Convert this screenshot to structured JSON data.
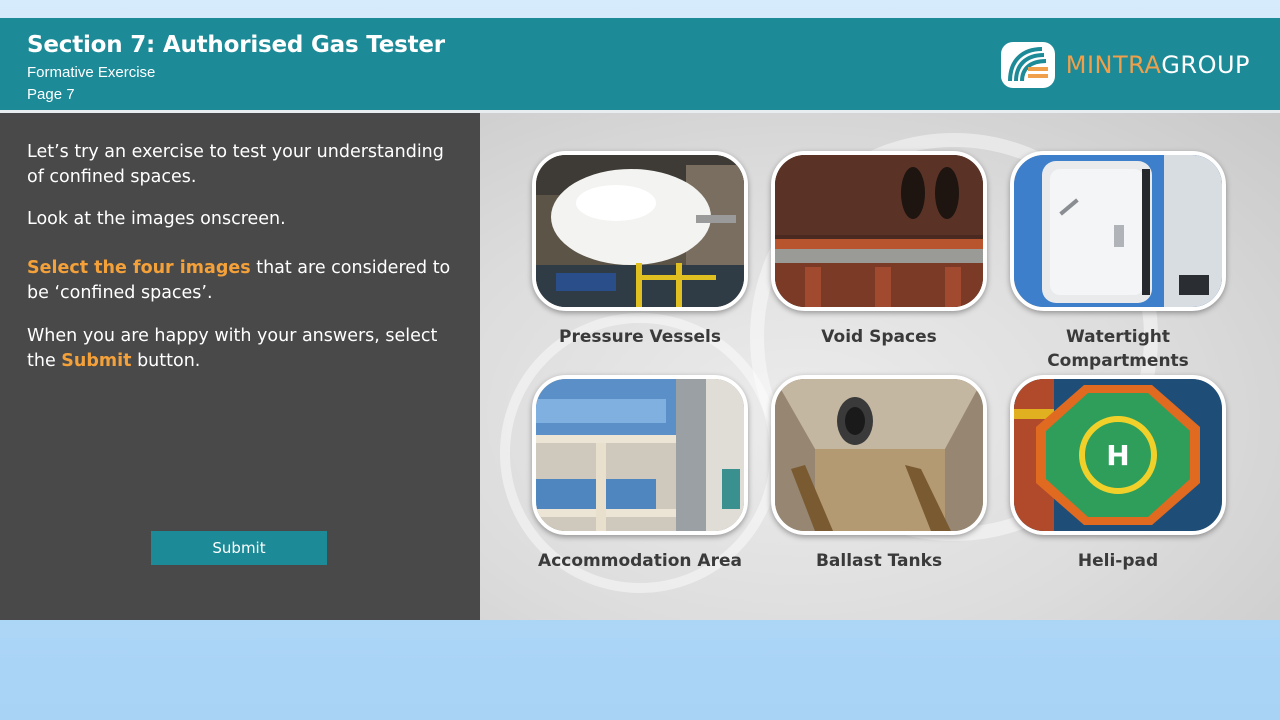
{
  "header": {
    "title": "Section 7: Authorised Gas Tester",
    "subtitle": "Formative Exercise",
    "page": "Page 7",
    "logo_word_1": "MINTRA",
    "logo_word_2": "GROUP"
  },
  "instructions": {
    "p1": "Let’s try an exercise to test your understanding of confined spaces.",
    "p2": "Look at the images onscreen.",
    "p3_highlight": "Select the four images",
    "p3_rest": " that are considered to be ‘confined spaces’.",
    "p4_before": "When you are happy with your answers, select the ",
    "p4_highlight": "Submit",
    "p4_after": " button."
  },
  "submit_label": "Submit",
  "options": [
    {
      "id": "pressure-vessels",
      "label": "Pressure Vessels"
    },
    {
      "id": "void-spaces",
      "label": "Void Spaces"
    },
    {
      "id": "watertight-compartments",
      "label": "Watertight Compartments"
    },
    {
      "id": "accommodation-area",
      "label": "Accommodation Area"
    },
    {
      "id": "ballast-tanks",
      "label": "Ballast Tanks"
    },
    {
      "id": "heli-pad",
      "label": "Heli-pad"
    }
  ],
  "colors": {
    "header_bg": "#1c8a97",
    "panel_bg": "#494949",
    "accent": "#f5a13a"
  }
}
